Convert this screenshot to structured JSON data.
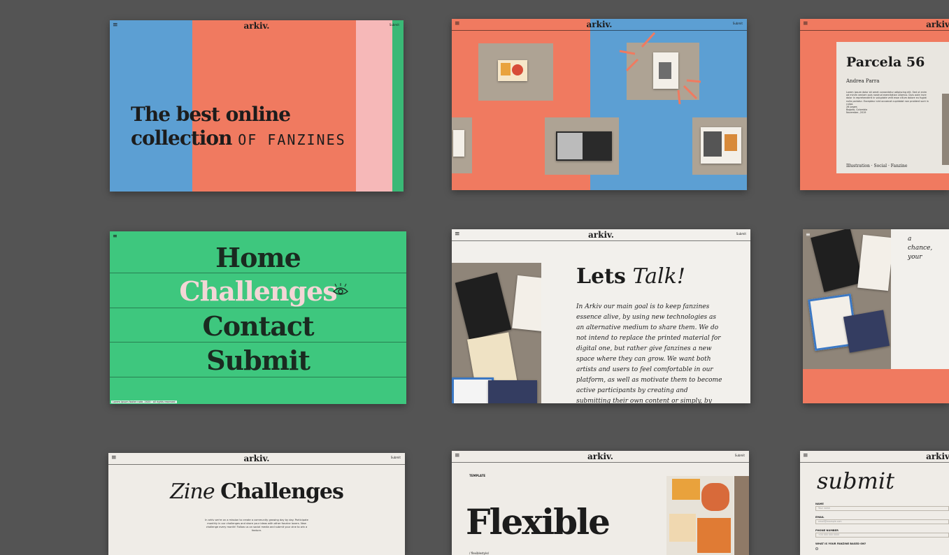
{
  "brand": "arkiv.",
  "header_link": "Submit",
  "cards": {
    "hero": {
      "title_line1": "The best online",
      "title_line2": "collection",
      "title_script": "OF FANZINES"
    },
    "gallery": {},
    "detail": {
      "title": "Parcela 56",
      "author": "Andrea Parra",
      "body": "Lorem ipsum dolor sit amet consectetur adipiscing elit. Sed ut enim ad minim veniam quis nostrud exercitation ullamco. Duis aute irure dolor in reprehenderit in voluptate velit esse cillum dolore eu fugiat nulla pariatur. Excepteur sint occaecat cupidatat non proident sunt in culpa.",
      "pages": "28 pages",
      "place": "Bogota, Colombia",
      "date": "November, 2019",
      "tags": "Illustration · Social · Fanzine"
    },
    "menu": {
      "items": [
        "Home",
        "Challenges",
        "Contact",
        "Submit"
      ],
      "footer_note": "Lorem ipsum footer note, 2020 · all rights reserved"
    },
    "contact": {
      "title_bold": "Lets",
      "title_italic": "Talk!",
      "letter": "In Arkiv our main goal is to keep fanzines essence alive, by using new technologies as an alternative medium to share them. We do not intend to replace the printed material for digital one, but rather give fanzines a new space where they can grow. We want both artists and users to feel comfortable in our platform, as well as motivate them to become active participants by creating and submitting their own content or simply, by sharing."
    },
    "contact_mobile": {
      "side_text_1": "a",
      "side_text_2": "chance,",
      "side_text_3": "your"
    },
    "challenges": {
      "title_italic": "Zine",
      "title_bold": "Challenges",
      "intro": "In arkiv we're on a mission to create a community growing day by day. Participate monthly in our challenges and share your ideas with other fanzine lovers. New challenge every month! Follow us on social media and submit your zine to win a feature."
    },
    "flexible": {
      "label": "TEMPLATE",
      "title": "Flexible",
      "sub_label": "/ flexiblestyle/"
    },
    "submit": {
      "title": "submit",
      "fields": [
        {
          "label": "NAME",
          "placeholder": "Your name"
        },
        {
          "label": "EMAIL",
          "placeholder": "email@example.com"
        },
        {
          "label": "PHONE NUMBER",
          "placeholder": "+00 000 000 0000"
        },
        {
          "label": "WHAT IS YOUR FANZINE BASED ON?",
          "placeholder": ""
        }
      ]
    }
  },
  "colors": {
    "backdrop": "#545454",
    "coral": "#f07a60",
    "blue": "#5c9fd3",
    "green": "#3ec77e",
    "pink": "#f6b8b8",
    "paper": "#efece7"
  }
}
